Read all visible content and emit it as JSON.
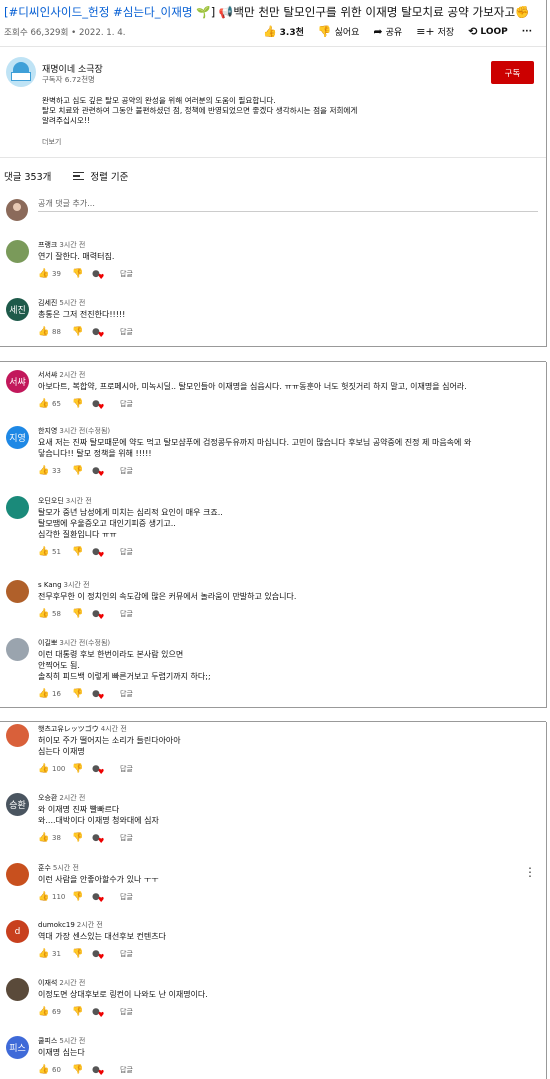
{
  "video": {
    "title_tags": "[#디씨인사이드_헌정 #심는다_이재명 ",
    "title_emoji1": "🌱",
    "title_rest": "] 📢백만 천만 탈모인구를 위한 이재명 탈모치료 공약 가보자고",
    "title_emoji2": "✊",
    "views_date": "조회수 66,329회 • 2022. 1. 4.",
    "likes": "3.3천",
    "dislike_label": "싫어요",
    "share_label": "공유",
    "save_label": "저장",
    "loop_label": "LOOP",
    "more_label": "···"
  },
  "channel": {
    "name": "재명이네 소극장",
    "subscribers": "구독자 6.72천명",
    "subscribe_label": "구독",
    "description": [
      "완벽하고 심도 깊은 탈모 공약의 완성을 위해 여러분의 도움이 필요합니다.",
      "탈모 치료와 관련하여 그동안 불편하셨던 점, 정책에 반영되었으면 좋겠다 생각하시는 점을 저희에게",
      "알려주십시오!!"
    ],
    "more_label": "더보기"
  },
  "comments_header": {
    "count": "댓글 353개",
    "sort_label": "정렬 기준",
    "add_placeholder": "공개 댓글 추가..."
  },
  "comments": [
    {
      "author": "프랭크",
      "time": "3시간 전",
      "avatar_text": "",
      "avatar_color": "#7a9a5a",
      "lines": [
        "연기 잘한다. 매력터짐."
      ],
      "likes": "39",
      "reply": "답글"
    },
    {
      "author": "김세진",
      "time": "5시간 전",
      "avatar_text": "세진",
      "avatar_color": "#1e5a4a",
      "lines": [
        "총통은 그저 전진한다!!!!!"
      ],
      "likes": "88",
      "reply": "답글"
    },
    {
      "author": "서서쌰",
      "time": "2시간 전",
      "avatar_text": "서쌰",
      "avatar_color": "#c2185b",
      "lines": [
        "아보다트, 복합약, 프로페시아, 미녹시딜.. 탈모인들아 이재명을 심읍시다. ㅠㅠ동훈아 너도 헛짓거리 하지 말고, 이재명을 심어라."
      ],
      "likes": "65",
      "reply": "답글"
    },
    {
      "author": "한지영",
      "time": "3시간 전(수정됨)",
      "avatar_text": "지영",
      "avatar_color": "#1e88e5",
      "lines": [
        "요새 저는 진짜 탈모때문에 약도 먹고 탈모샴푸에 검정콩두유까지 마십니다. 고민이 많습니다 후보님 공약중에 진정 제 마음속에 와",
        "닿습니다!! 탈모 정책을 위해 !!!!!"
      ],
      "likes": "33",
      "reply": "답글"
    },
    {
      "author": "오딘오딘",
      "time": "3시간 전",
      "avatar_text": "",
      "avatar_color": "#1a8a7a",
      "lines": [
        "탈모가 중년 남성에게 미치는 심리적 요인이 매우 크죠..",
        "탈모땜에 우울증오고 대인기피증 생기고..",
        "심각한 질환입니다 ㅠㅠ"
      ],
      "likes": "51",
      "reply": "답글"
    },
    {
      "author": "s Kang",
      "time": "3시간 전",
      "avatar_text": "",
      "avatar_color": "#b0602a",
      "lines": [
        "전무후무한 이 정치인의 속도감에 많은 커뮤에서 놀라움이 만발하고 있습니다."
      ],
      "likes": "58",
      "reply": "답글"
    },
    {
      "author": "이길뽀",
      "time": "3시간 전(수정됨)",
      "avatar_text": "",
      "avatar_color": "#9aa4ae",
      "lines": [
        "이런 대통령 후보 한번이라도 본사람 있으면",
        "안찍어도 됨.",
        "솔직히 피드백 이렇게 빠른거보고 두렵기까지 하다;;"
      ],
      "likes": "16",
      "reply": "답글"
    },
    {
      "author": "햇츠고유レッツゴウ",
      "time": "4시간 전",
      "avatar_text": "",
      "avatar_color": "#d9603a",
      "lines": [
        "허이모 주가 떨어지는 소리가 들린다아아아",
        "심는다 이재명"
      ],
      "likes": "100",
      "reply": "답글"
    },
    {
      "author": "오승환",
      "time": "2시간 전",
      "avatar_text": "승환",
      "avatar_color": "#4a5560",
      "lines": [
        "와 이재명 진짜 빨빠르다",
        "와....대박이다 이재명 청와대에 심자"
      ],
      "likes": "38",
      "reply": "답글"
    },
    {
      "author": "훈수",
      "time": "5시간 전",
      "avatar_text": "",
      "avatar_color": "#c8501e",
      "lines": [
        "이런 사람을 안좋아할수가 있나 ㅜㅜ"
      ],
      "likes": "110",
      "reply": "답글",
      "kebab": "⋮"
    },
    {
      "author": "dumokc19",
      "time": "2시간 전",
      "avatar_text": "d",
      "avatar_color": "#c8401e",
      "lines": [
        "역대 가장 센스있는 대선후보 컨텐츠다"
      ],
      "likes": "31",
      "reply": "답글"
    },
    {
      "author": "이재석",
      "time": "2시간 전",
      "avatar_text": "",
      "avatar_color": "#5a4a3a",
      "lines": [
        "이정도면 상대후보로 링컨이 나와도 난 이재명이다."
      ],
      "likes": "69",
      "reply": "답글"
    },
    {
      "author": "쿨피스",
      "time": "5시간 전",
      "avatar_text": "피스",
      "avatar_color": "#3f6ad8",
      "lines": [
        "이재명 심는다"
      ],
      "likes": "60",
      "reply": "답글"
    }
  ]
}
